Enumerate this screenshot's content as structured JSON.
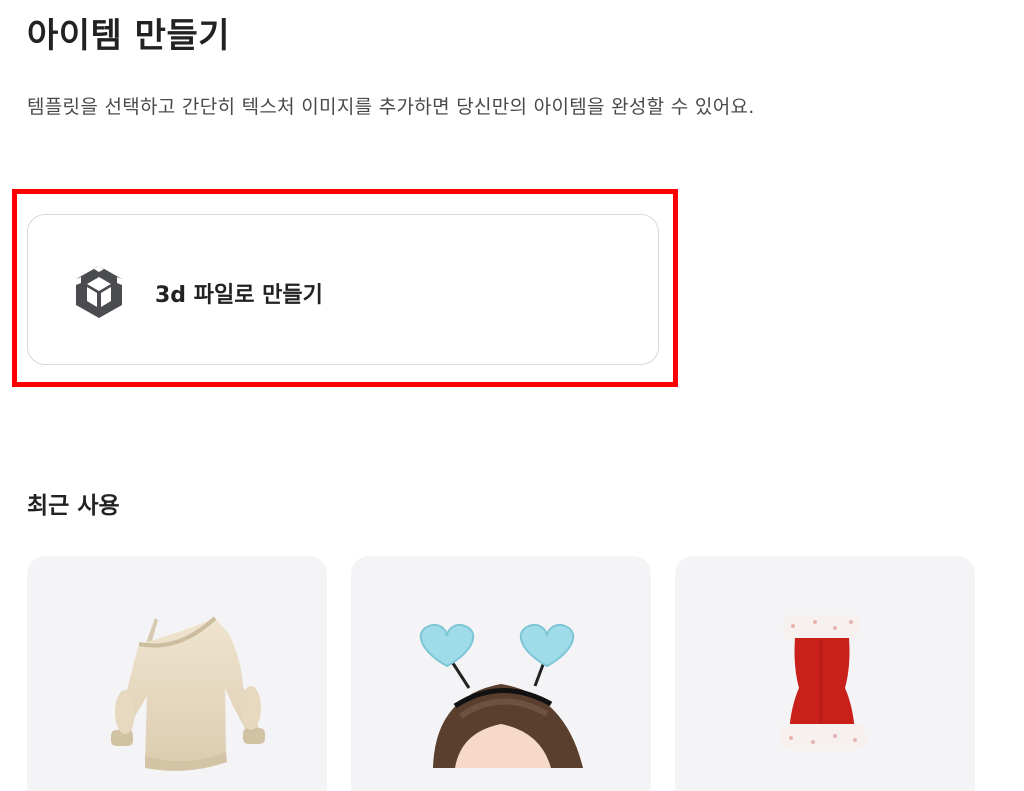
{
  "page": {
    "title": "아이템 만들기",
    "description": "템플릿을 선택하고 간단히 텍스처 이미지를 추가하면 당신만의 아이템을 완성할 수 있어요."
  },
  "create_option": {
    "label": "3d 파일로 만들기",
    "icon": "unity-icon"
  },
  "recent": {
    "title": "최근 사용",
    "items": [
      {
        "icon": "off-shoulder-sweater-thumbnail"
      },
      {
        "icon": "heart-headband-thumbnail"
      },
      {
        "icon": "red-tube-dress-thumbnail"
      }
    ]
  },
  "colors": {
    "highlight": "#ff0000",
    "card_bg": "#f4f4f7",
    "title_text": "#222222"
  }
}
